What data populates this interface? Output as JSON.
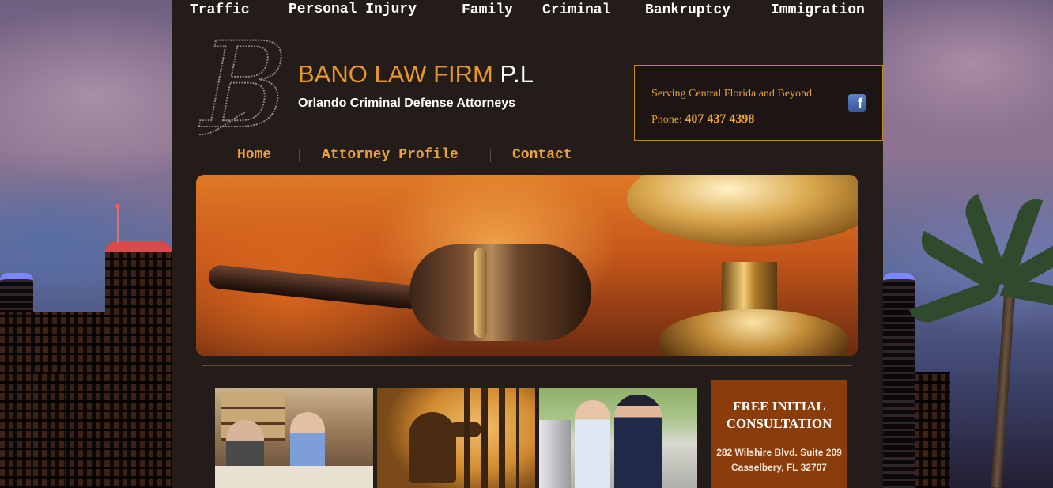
{
  "top_nav": {
    "items": [
      "Traffic",
      "Personal Injury",
      "Family",
      "Criminal",
      "Bankruptcy",
      "Immigration"
    ]
  },
  "brand": {
    "logo_letter": "B",
    "name": "BANO LAW FIRM",
    "suffix": "P.L",
    "tagline": "Orlando Criminal Defense Attorneys"
  },
  "contact": {
    "serving": "Serving Central Florida and Beyond",
    "phone_label": "Phone:",
    "phone_number": "407 437 4398",
    "facebook_icon": "facebook-icon",
    "facebook_glyph": "f"
  },
  "main_nav": {
    "items": [
      "Home",
      "Attorney Profile",
      "Contact"
    ]
  },
  "cta": {
    "title_line1": "FREE INITIAL",
    "title_line2": "CONSULTATION",
    "address_line1": "282 Wilshire Blvd. Suite 209",
    "address_line2": "Casselbery, FL 32707"
  },
  "colors": {
    "panel": "#241c19",
    "accent": "#e8972a",
    "cta": "#8a3c0a"
  }
}
